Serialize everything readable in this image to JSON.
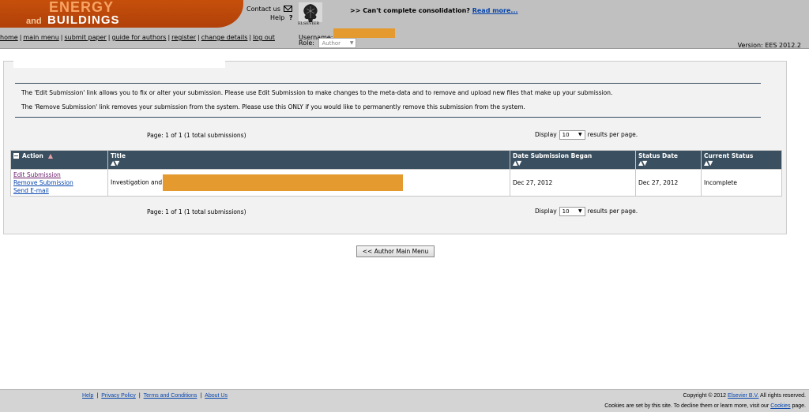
{
  "logo": {
    "line1": "ENERGY",
    "and": "and",
    "line2": "BUILDINGS"
  },
  "contact": {
    "label": "Contact us",
    "help": "Help",
    "help_mark": "?"
  },
  "publisher": {
    "name": "ELSEVIER"
  },
  "notice": {
    "text": ">> Can't complete consolidation?",
    "link": "Read more..."
  },
  "user": {
    "username_label": "Username:",
    "role_label": "Role:",
    "role_value": "Author"
  },
  "nav": [
    "home",
    "main menu",
    "submit paper",
    "guide for authors",
    "register",
    "change details",
    "log out"
  ],
  "nav_sep": "|",
  "version": "Version: EES 2012.2",
  "info": {
    "edit_text": "The 'Edit Submission' link allows you to fix or alter your submission. Please use Edit Submission to make changes to the meta-data and to remove and upload new files that make up your submission.",
    "remove_text": "The 'Remove Submission' link removes your submission from the system. Please use this ONLY if you would like to permanently remove this submission from the system."
  },
  "pagination": {
    "page_text": "Page: 1 of 1 (1 total submissions)",
    "display_label": "Display",
    "per_page_value": "10",
    "results_label": "results per page."
  },
  "table": {
    "headers": [
      "Action",
      "Title",
      "Date Submission Began",
      "Status Date",
      "Current Status"
    ],
    "sort_glyph": "▲▼",
    "rows": [
      {
        "actions": [
          "Edit Submission",
          "Remove Submission",
          "Send E-mail"
        ],
        "title": "Investigation and",
        "date_began": "Dec 27, 2012",
        "status_date": "Dec 27, 2012",
        "status": "Incomplete"
      }
    ]
  },
  "button": {
    "author_main_menu": "<< Author Main Menu"
  },
  "footer": {
    "links": [
      "Help",
      "Privacy Policy",
      "Terms and Conditions",
      "About Us"
    ],
    "sep": "|",
    "copyright_prefix": "Copyright © 2012",
    "copyright_link": "Elsevier B.V.",
    "copyright_suffix": "All rights reserved.",
    "cookie_prefix": "Cookies are set by this site. To decline them or learn more, visit our",
    "cookie_link": "Cookies",
    "cookie_suffix": "page."
  },
  "colors": {
    "logo_orange": "#c64f0b",
    "table_header": "#3a4f5f",
    "redaction": "#e49a2f",
    "header_gray": "#c0c0c0"
  }
}
